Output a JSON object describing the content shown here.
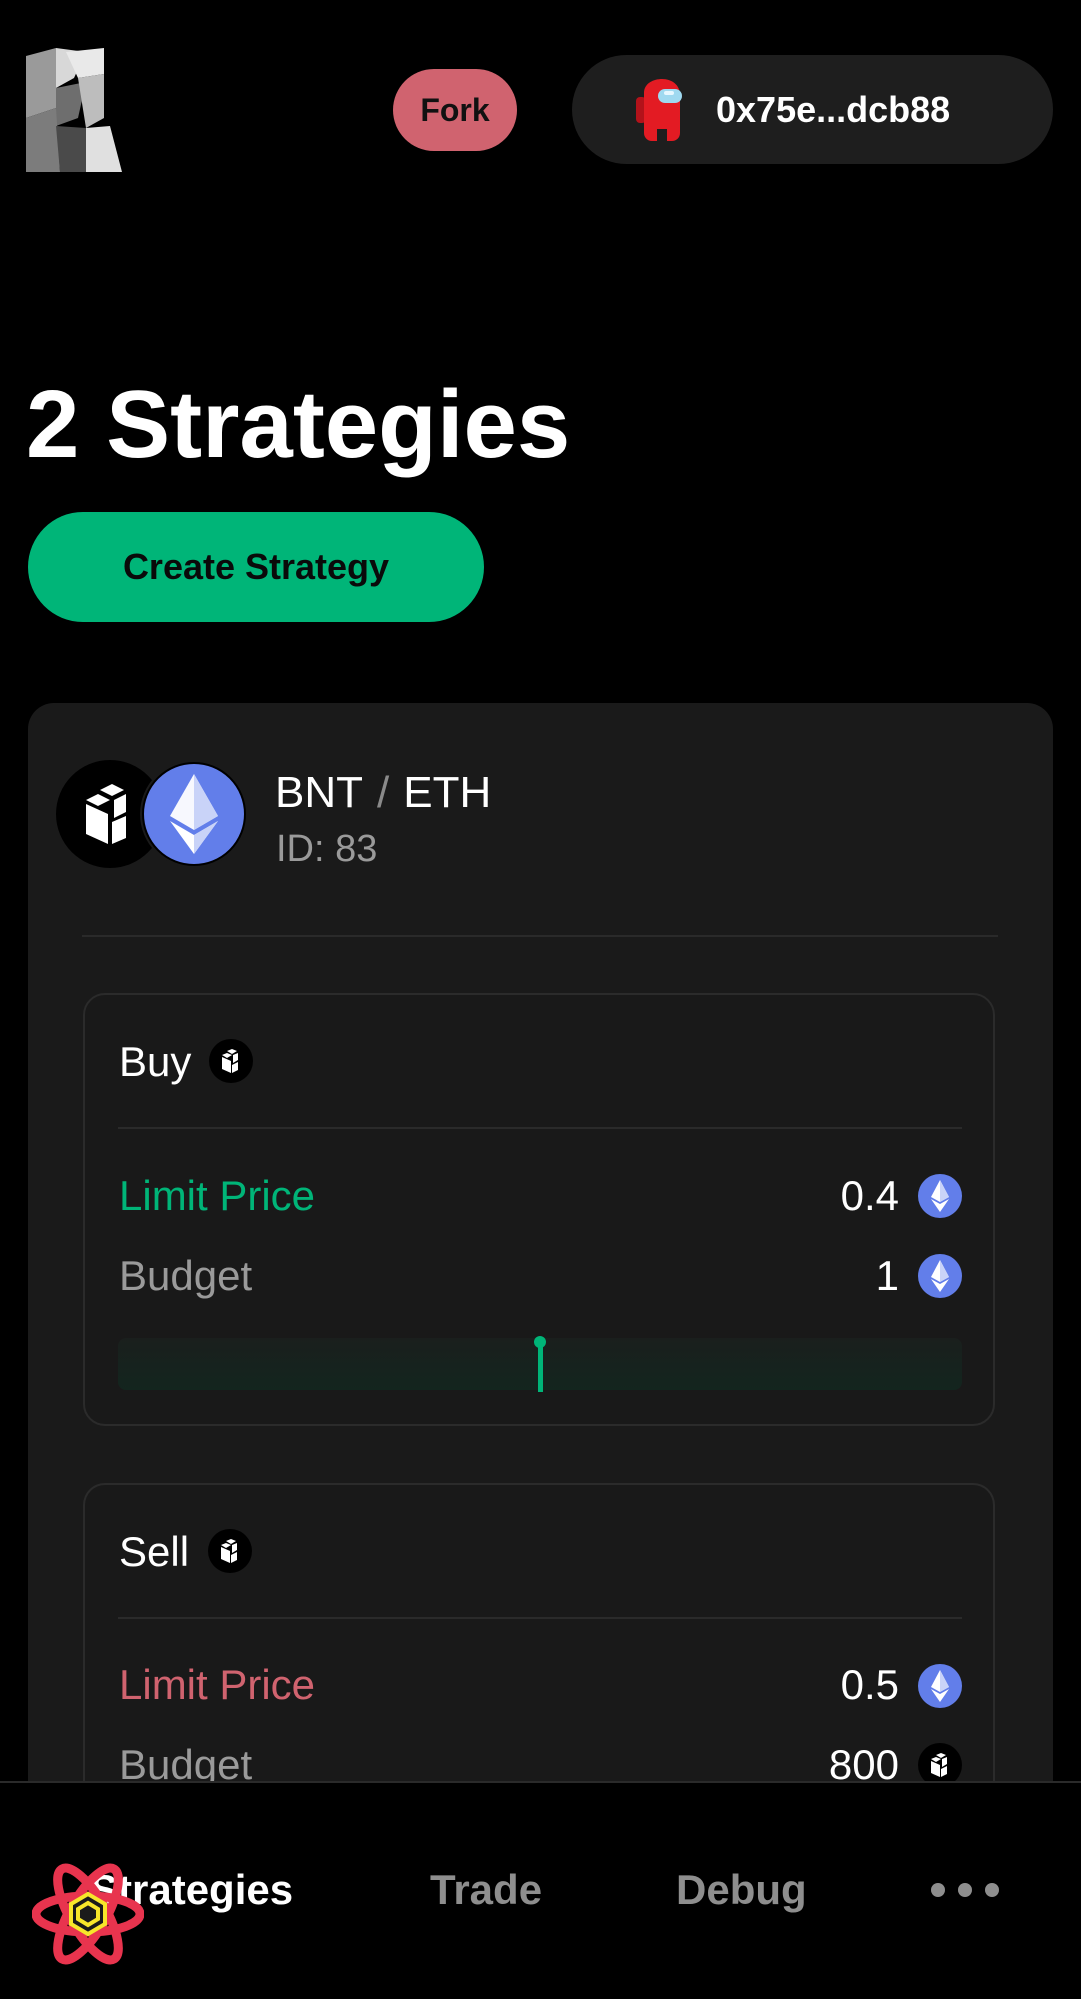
{
  "header": {
    "logo_icon": "carbon-logo-icon",
    "fork_label": "Fork",
    "wallet_avatar_icon": "red-crewmate-avatar-icon",
    "wallet_address": "0x75e...dcb88"
  },
  "page": {
    "title": "2 Strategies",
    "create_label": "Create Strategy"
  },
  "strategy": {
    "base_token": "BNT",
    "separator": "/",
    "quote_token": "ETH",
    "id_text": "ID: 83",
    "buy": {
      "title": "Buy",
      "limit_label": "Limit Price",
      "limit_value": "0.4",
      "budget_label": "Budget",
      "budget_value": "1",
      "token_icon": "bancor-token-icon",
      "value_icon": "ethereum-token-icon"
    },
    "sell": {
      "title": "Sell",
      "limit_label": "Limit Price",
      "limit_value": "0.5",
      "budget_label": "Budget",
      "budget_value": "800",
      "token_icon": "bancor-token-icon"
    }
  },
  "nav": {
    "strategies_label": "Strategies",
    "trade_label": "Trade",
    "debug_label": "Debug",
    "more_icon": "more-dots-icon"
  },
  "colors": {
    "accent_green": "#00b578",
    "sell_red": "#d0636f",
    "fork_red": "#d0636f",
    "eth_blue": "#627eea"
  }
}
